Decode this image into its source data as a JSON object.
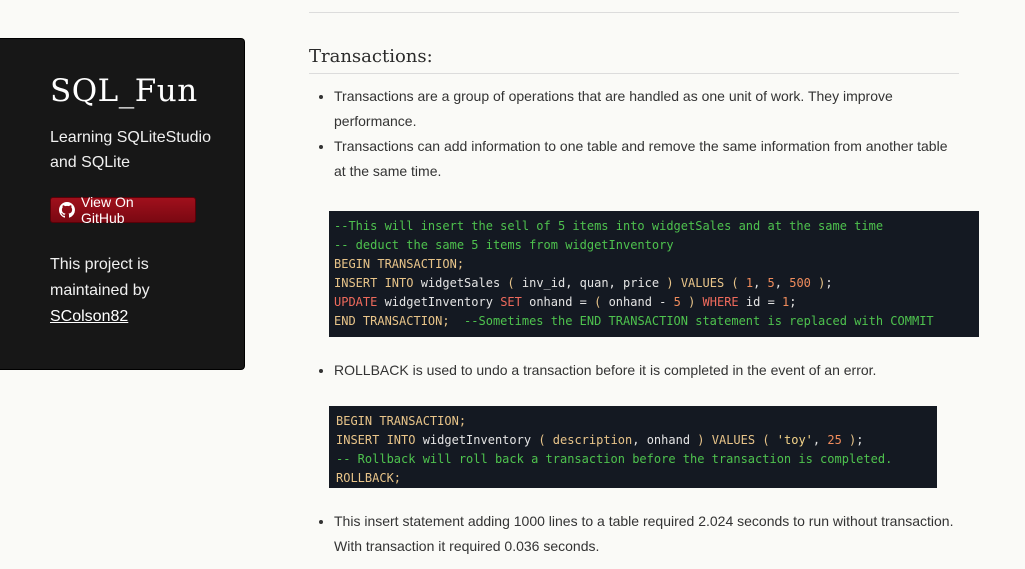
{
  "sidebar": {
    "title": "SQL_Fun",
    "description": "Learning SQLiteStudio and SQLite",
    "github_button_label": "View On GitHub",
    "maintainer_prefix": "This project is maintained by",
    "maintainer_link": "SColson82"
  },
  "main": {
    "section_title": "Transactions:",
    "bullets_1": [
      "Transactions are a group of operations that are handled as one unit of work. They improve performance.",
      "Transactions can add information to one table and remove the same information from another table at the same time."
    ],
    "code_1": {
      "line1": "--This will insert the sell of 5 items into widgetSales and at the same time",
      "line2": "-- deduct the same 5 items from widgetInventory",
      "line3": "BEGIN TRANSACTION;",
      "line4_kw1": "INSERT INTO",
      "line4_t1": " widgetSales ",
      "line4_p1": "(",
      "line4_t2": " inv_id, quan, price ",
      "line4_p2": ")",
      "line4_kw2": " VALUES ",
      "line4_p3": "(",
      "line4_n1": "1",
      "line4_n2": "5",
      "line4_n3": "500",
      "line4_p4": ")",
      "line4_end": ";",
      "line5_kw1": "UPDATE",
      "line5_t1": " widgetInventory ",
      "line5_kw2": "SET",
      "line5_t2": " onhand = ",
      "line5_p1": "(",
      "line5_t3": " onhand - ",
      "line5_n1": "5",
      "line5_p2": ")",
      "line5_kw3": " WHERE",
      "line5_t4": " id = ",
      "line5_n2": "1",
      "line5_end": ";",
      "line6_kw": "END TRANSACTION;",
      "line6_cm": "--Sometimes the END TRANSACTION statement is replaced with COMMIT"
    },
    "bullet_2": "ROLLBACK is used to undo a transaction before it is completed in the event of an error.",
    "code_2": {
      "line1": "BEGIN TRANSACTION;",
      "line2_kw1": "INSERT INTO",
      "line2_t1": " widgetInventory ",
      "line2_p1": "(",
      "line2_t2": " description",
      "line2_t3": ", onhand ",
      "line2_p2": ")",
      "line2_kw2": " VALUES ",
      "line2_p3": "(",
      "line2_s1": "'toy'",
      "line2_n1": "25",
      "line2_p4": ")",
      "line2_end": ";",
      "line3": "-- Rollback will roll back a transaction before the transaction is completed.",
      "line4": "ROLLBACK;"
    },
    "bullet_3": "This insert statement adding 1000 lines to a table required 2.024 seconds to run without transaction. With transaction it required 0.036 seconds."
  },
  "colors": {
    "sidebar_bg": "#171717",
    "button_bg": "#8e0c17",
    "code_bg": "#141922",
    "comment": "#4ec24e",
    "keyword": "#e8c489",
    "keyword_red": "#ef6a5c",
    "number": "#f08c5c"
  },
  "icons": {
    "github": "github-octocat-icon"
  }
}
